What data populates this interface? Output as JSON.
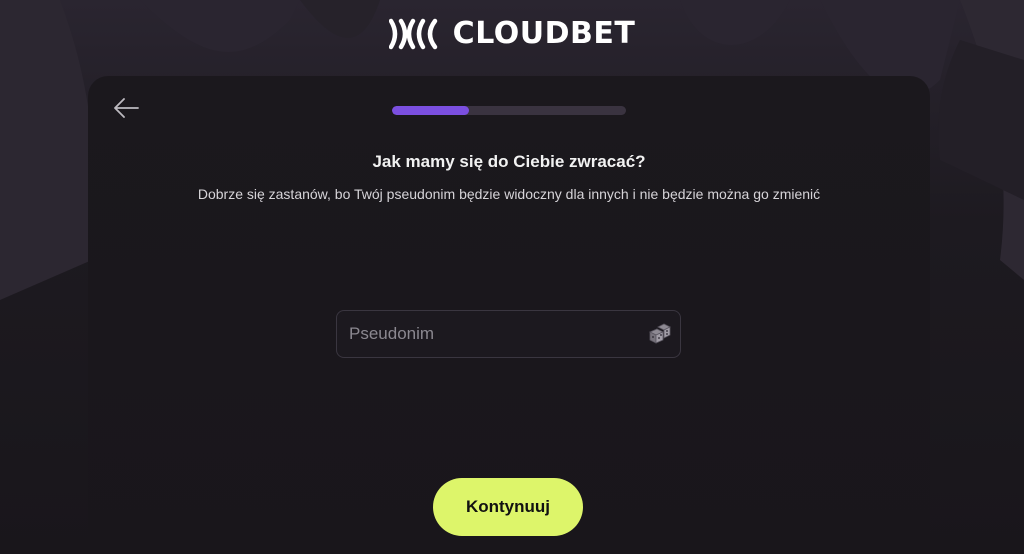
{
  "brand": {
    "name": "CLOUDBET"
  },
  "header": {
    "back_icon": "arrow-left-icon"
  },
  "progress": {
    "value": 0.33,
    "color": "#7b4fe0"
  },
  "content": {
    "heading": "Jak mamy się do Ciebie zwracać?",
    "subtext": "Dobrze się zastanów, bo Twój pseudonim będzie widoczny dla innych i nie będzie można go zmienić"
  },
  "nickname_field": {
    "value": "",
    "placeholder": "Pseudonim",
    "action_icon": "dice-icon"
  },
  "actions": {
    "continue_label": "Kontynuuj",
    "continue_color": "#ddf56a"
  }
}
